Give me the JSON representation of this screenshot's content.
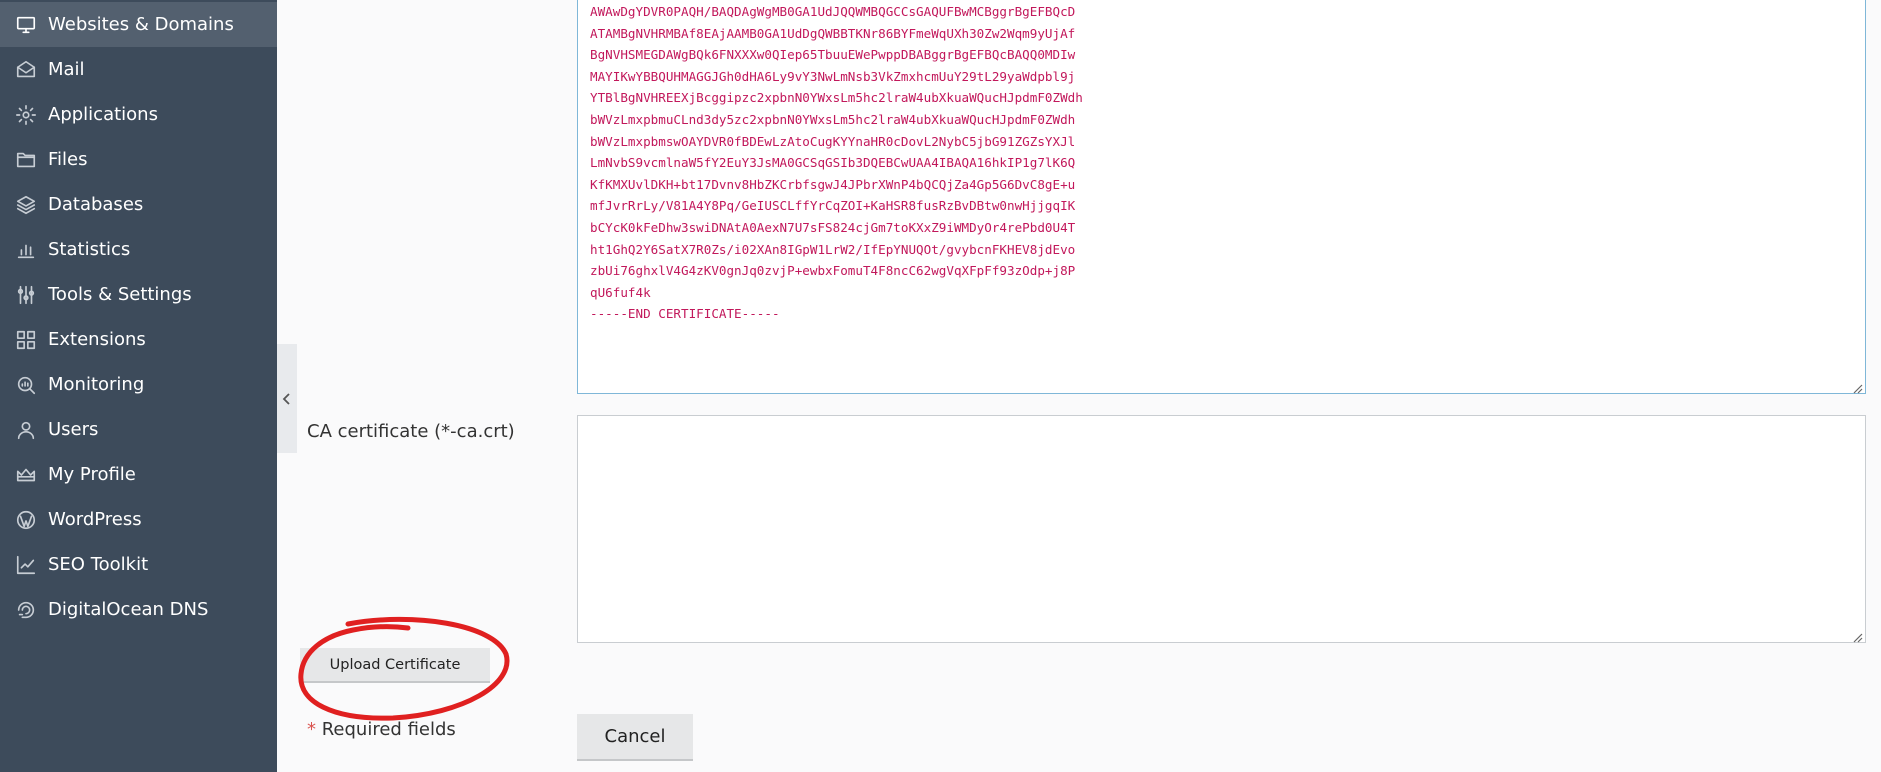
{
  "sidebar": {
    "items": [
      {
        "label": "Websites & Domains",
        "icon": "monitor-icon",
        "active": true
      },
      {
        "label": "Mail",
        "icon": "envelope-icon"
      },
      {
        "label": "Applications",
        "icon": "gear-icon"
      },
      {
        "label": "Files",
        "icon": "folder-icon"
      },
      {
        "label": "Databases",
        "icon": "layers-icon"
      },
      {
        "label": "Statistics",
        "icon": "bar-chart-icon"
      },
      {
        "label": "Tools & Settings",
        "icon": "sliders-icon"
      },
      {
        "label": "Extensions",
        "icon": "grid-icon"
      },
      {
        "label": "Monitoring",
        "icon": "magnify-chart-icon"
      },
      {
        "label": "Users",
        "icon": "user-icon"
      },
      {
        "label": "My Profile",
        "icon": "crown-icon"
      },
      {
        "label": "WordPress",
        "icon": "wordpress-icon"
      },
      {
        "label": "SEO Toolkit",
        "icon": "trend-chart-icon"
      },
      {
        "label": "DigitalOcean DNS",
        "icon": "digitalocean-icon"
      }
    ]
  },
  "certificate": {
    "lines": [
      "AWAwDgYDVR0PAQH/BAQDAgWgMB0GA1UdJQQWMBQGCCsGAQUFBwMCBggrBgEFBQcD",
      "ATAMBgNVHRMBAf8EAjAAMB0GA1UdDgQWBBTKNr86BYFmeWqUXh30Zw2Wqm9yUjAf",
      "BgNVHSMEGDAWgBQk6FNXXXw0QIep65TbuuEWePwppDBABggrBgEFBQcBAQQ0MDIw",
      "MAYIKwYBBQUHMAGGJGh0dHA6Ly9vY3NwLmNsb3VkZmxhcmUuY29tL29yaWdpbl9j",
      "YTBlBgNVHREEXjBcggipzc2xpbnN0YWxsLm5hc2lraW4ubXkuaWQucHJpdmF0ZWdh",
      "bWVzLmxpbmuCLnd3dy5zc2xpbnN0YWxsLm5hc2lraW4ubXkuaWQucHJpdmF0ZWdh",
      "bWVzLmxpbmswOAYDVR0fBDEwLzAtoCugKYYnaHR0cDovL2NybC5jbG91ZGZsYXJl",
      "LmNvbS9vcmlnaW5fY2EuY3JsMA0GCSqGSIb3DQEBCwUAA4IBAQA16hkIP1g7lK6Q",
      "KfKMXUvlDKH+bt17Dvnv8HbZKCrbfsgwJ4JPbrXWnP4bQCQjZa4Gp5G6DvC8gE+u",
      "mfJvrRrLy/V81A4Y8Pq/GeIUSCLffYrCqZOI+KaHSR8fusRzBvDBtw0nwHjjgqIK",
      "bCYcK0kFeDhw3swiDNAtA0AexN7U7sFS824cjGm7toKXxZ9iWMDyOr4rePbd0U4T",
      "ht1GhQ2Y6SatX7R0Zs/i02XAn8IGpW1LrW2/IfEpYNUQOt/gvybcnFKHEV8jdEvo",
      "zbUi76ghxlV4G4zKV0gnJq0zvjP+ewbxFomuT4F8ncC62wgVqXFpFf93zOdp+j8P",
      "qU6fuf4k",
      "-----END CERTIFICATE-----"
    ]
  },
  "ca_certificate": {
    "label": "CA certificate (*-ca.crt)",
    "value": ""
  },
  "buttons": {
    "upload": "Upload Certificate",
    "cancel": "Cancel"
  },
  "required_note": {
    "star": "*",
    "text": "Required fields"
  },
  "colors": {
    "sidebar_bg": "#3d4b5b",
    "sidebar_active": "#53606f",
    "cert_text": "#c2185b",
    "annotation": "#e02020"
  }
}
